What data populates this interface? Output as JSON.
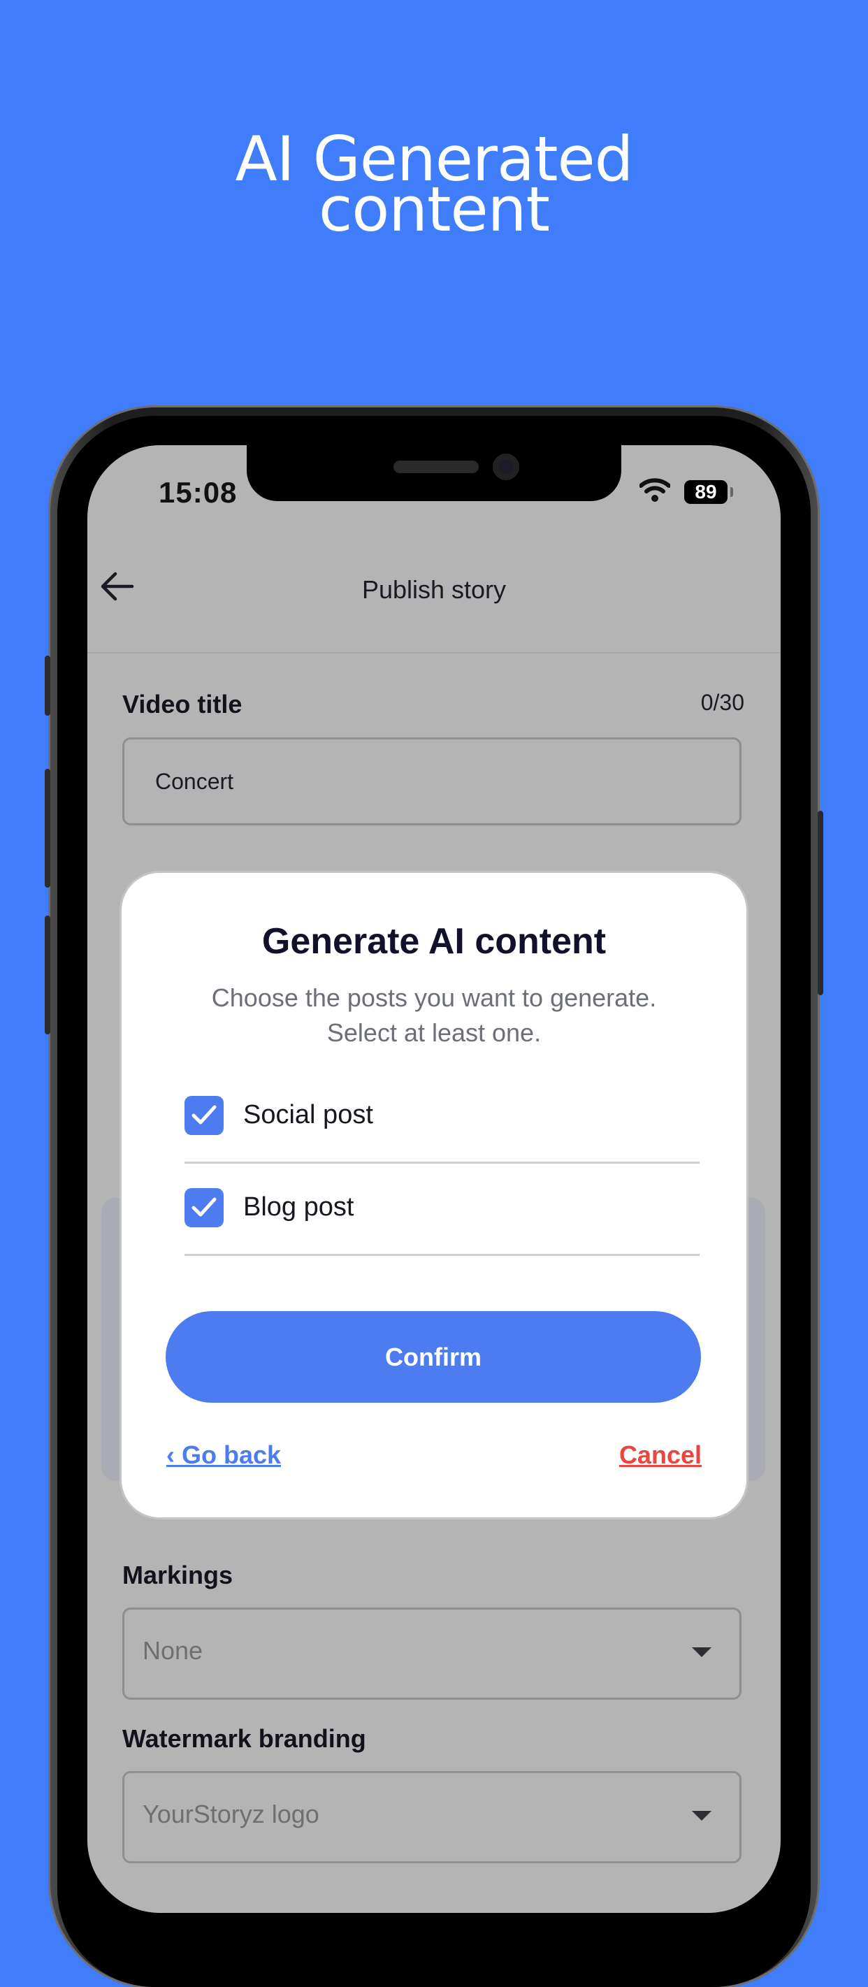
{
  "headline": {
    "line1": "AI Generated",
    "line2": "content"
  },
  "status_bar": {
    "time": "15:08",
    "battery": "89"
  },
  "header": {
    "title": "Publish story"
  },
  "form": {
    "video_title_label": "Video title",
    "video_title_counter": "0/30",
    "video_title_value": "Concert",
    "markings_label": "Markings",
    "markings_value": "None",
    "watermark_label": "Watermark branding",
    "watermark_value": "YourStoryz logo"
  },
  "modal": {
    "title": "Generate AI content",
    "subtitle_line1": "Choose the posts you want to generate.",
    "subtitle_line2": "Select at least one.",
    "options": [
      {
        "label": "Social post",
        "checked": true
      },
      {
        "label": "Blog post",
        "checked": true
      }
    ],
    "confirm_label": "Confirm",
    "go_back_label": "‹ Go back",
    "cancel_label": "Cancel"
  },
  "colors": {
    "background": "#3f7dfb",
    "accent": "#4c7cf0",
    "danger": "#e8463e",
    "overlay": "#b4b4b4"
  }
}
